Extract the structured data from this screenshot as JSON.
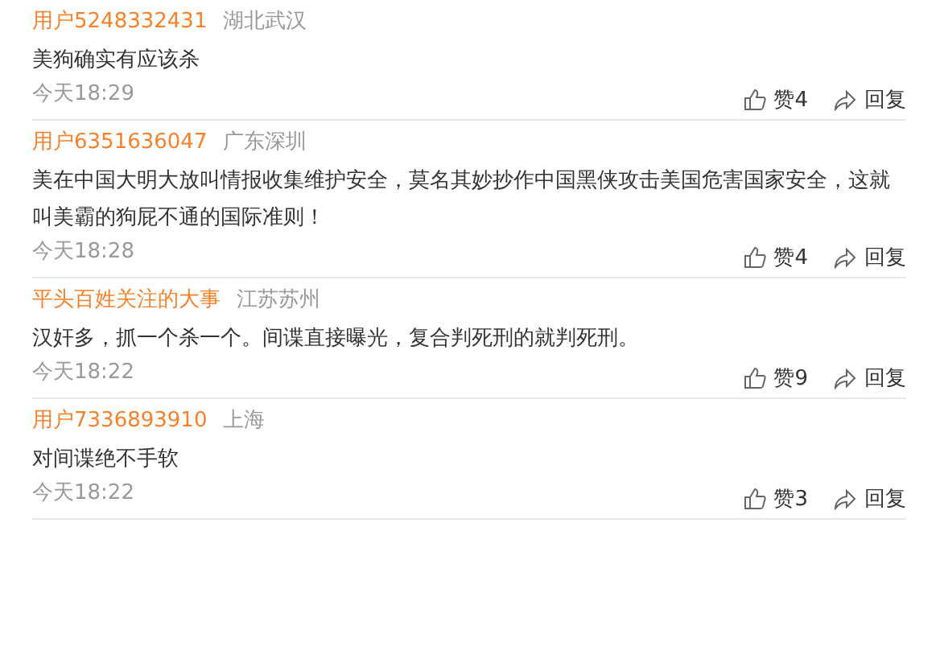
{
  "comments": [
    {
      "user": "用户5248332431",
      "location": "湖北武汉",
      "text": "美狗确实有应该杀",
      "time": "今天18:29",
      "likes": "赞4",
      "reply": "回复"
    },
    {
      "user": "用户6351636047",
      "location": "广东深圳",
      "text": "美在中国大明大放叫情报收集维护安全，莫名其妙抄作中国黑侠攻击美国危害国家安全，这就叫美霸的狗屁不通的国际准则！",
      "time": "今天18:28",
      "likes": "赞4",
      "reply": "回复"
    },
    {
      "user": "平头百姓关注的大事",
      "location": "江苏苏州",
      "text": "汉奸多，抓一个杀一个。间谍直接曝光，复合判死刑的就判死刑。",
      "time": "今天18:22",
      "likes": "赞9",
      "reply": "回复"
    },
    {
      "user": "用户7336893910",
      "location": "上海",
      "text": "对间谍绝不手软",
      "time": "今天18:22",
      "likes": "赞3",
      "reply": "回复"
    }
  ]
}
